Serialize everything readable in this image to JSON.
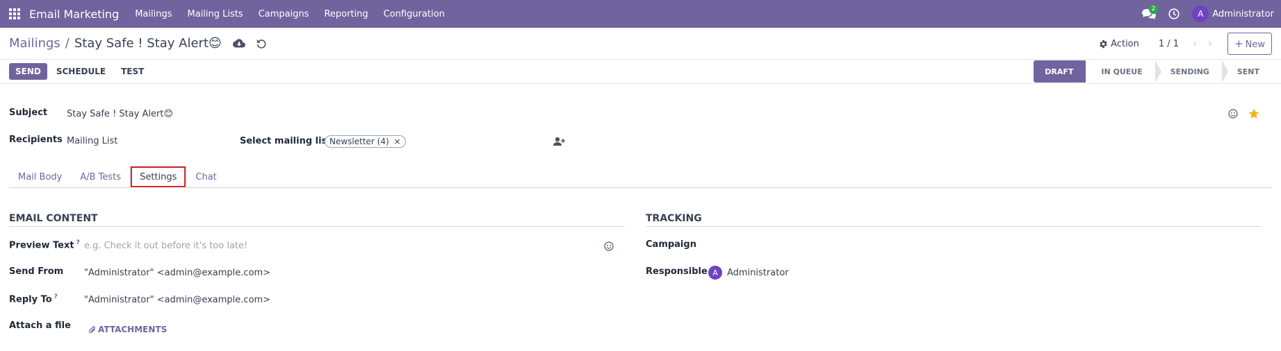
{
  "navbar": {
    "app_name": "Email Marketing",
    "menu": [
      "Mailings",
      "Mailing Lists",
      "Campaigns",
      "Reporting",
      "Configuration"
    ],
    "messages_badge": "2",
    "user_initial": "A",
    "user_name": "Administrator",
    "accent": "#71639e"
  },
  "control_panel": {
    "breadcrumb_parent": "Mailings",
    "breadcrumb_separator": "/",
    "breadcrumb_current": "Stay Safe ! Stay Alert😊",
    "action_label": "Action",
    "pager": "1 / 1",
    "new_label": "New"
  },
  "statusbar": {
    "buttons": [
      "SEND",
      "SCHEDULE",
      "TEST"
    ],
    "stages": [
      "DRAFT",
      "IN QUEUE",
      "SENDING",
      "SENT"
    ],
    "active_stage": "DRAFT"
  },
  "form": {
    "subject_label": "Subject",
    "subject_value": "Stay Safe ! Stay Alert😊",
    "recipients_label": "Recipients",
    "recipients_value": "Mailing List",
    "mailing_lists_label": "Select mailing lists:",
    "mailing_list_tag": "Newsletter (4)",
    "tag_remove": "×"
  },
  "tabs": [
    "Mail Body",
    "A/B Tests",
    "Settings",
    "Chat"
  ],
  "active_tab": "Settings",
  "email_content": {
    "title": "EMAIL CONTENT",
    "preview_text_label": "Preview Text",
    "preview_text_placeholder": "e.g. Check it out before it's too late!",
    "send_from_label": "Send From",
    "send_from_value": "\"Administrator\" <admin@example.com>",
    "reply_to_label": "Reply To",
    "reply_to_value": "\"Administrator\" <admin@example.com>",
    "attach_label": "Attach a file",
    "attachments_button": "ATTACHMENTS",
    "help_mark": "?"
  },
  "tracking": {
    "title": "TRACKING",
    "campaign_label": "Campaign",
    "campaign_value": "",
    "responsible_label": "Responsible",
    "responsible_initial": "A",
    "responsible_value": "Administrator"
  }
}
